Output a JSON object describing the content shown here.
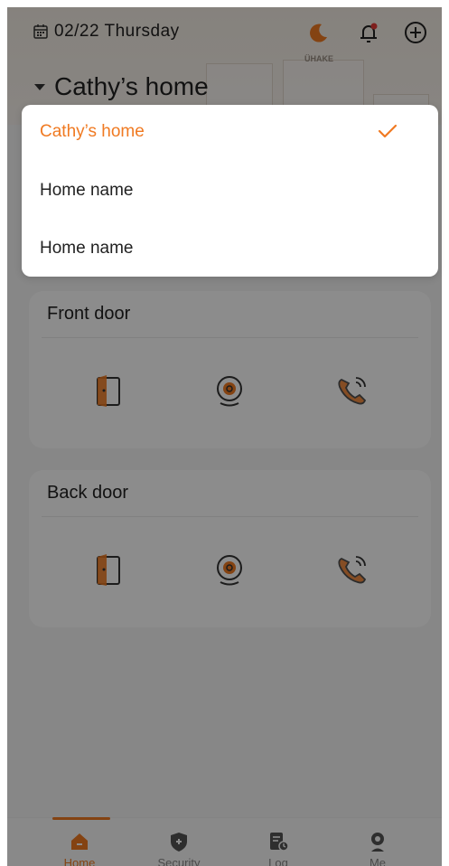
{
  "header": {
    "date": "02/22 Thursday",
    "home_title": "Cathy’s home",
    "brand_text": "ÜHAKE"
  },
  "home_dropdown": {
    "options": [
      {
        "label": "Cathy’s home",
        "selected": true
      },
      {
        "label": "Home name",
        "selected": false
      },
      {
        "label": "Home name",
        "selected": false
      }
    ]
  },
  "devices": [
    {
      "name": "Front door",
      "actions": [
        "door-icon",
        "camera-icon",
        "call-icon"
      ]
    },
    {
      "name": "Back door",
      "actions": [
        "door-icon",
        "camera-icon",
        "call-icon"
      ]
    }
  ],
  "tabbar": {
    "tabs": [
      {
        "label": "Home",
        "active": true
      },
      {
        "label": "Security",
        "active": false
      },
      {
        "label": "Log",
        "active": false
      },
      {
        "label": "Me",
        "active": false
      }
    ]
  },
  "colors": {
    "accent": "#f07a22",
    "overlay": "rgba(0,0,0,0.45)",
    "notification_dot": "#e53935"
  }
}
